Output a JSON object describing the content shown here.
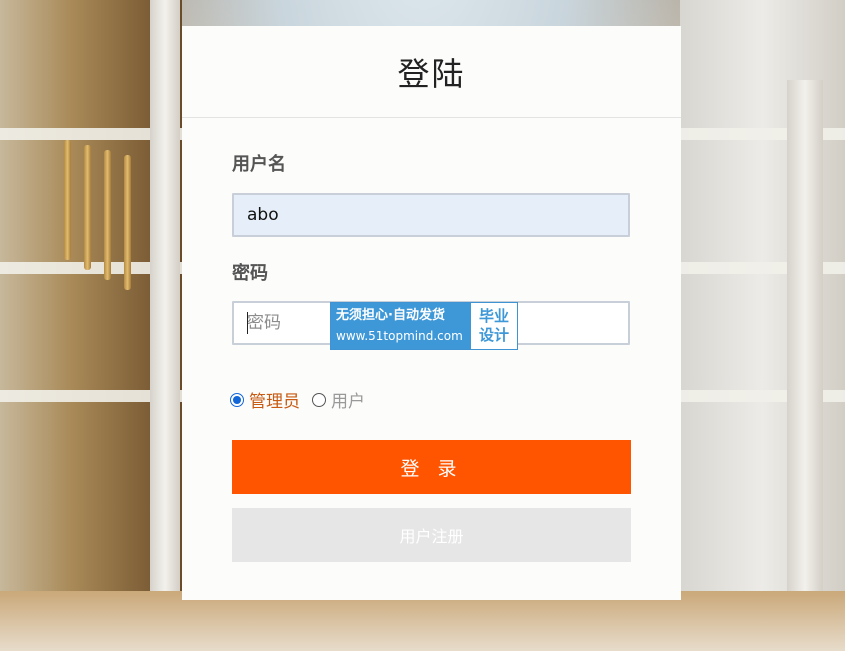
{
  "login": {
    "title": "登陆",
    "username_label": "用户名",
    "username_value": "abo",
    "password_label": "密码",
    "password_placeholder": "密码",
    "roles": [
      {
        "label": "管理员",
        "selected": true
      },
      {
        "label": "用户",
        "selected": false
      }
    ],
    "login_button": "登 录",
    "register_button": "用户注册"
  },
  "watermark": {
    "line1": "无须担心·自动发货",
    "url": "www.51topmind.com",
    "badge_line1": "毕业",
    "badge_line2": "设计"
  },
  "colors": {
    "login_button": "#ff5400",
    "register_button": "#e6e6e6",
    "radio_selected": "#1266d8",
    "watermark_blue": "#3e98d8"
  }
}
